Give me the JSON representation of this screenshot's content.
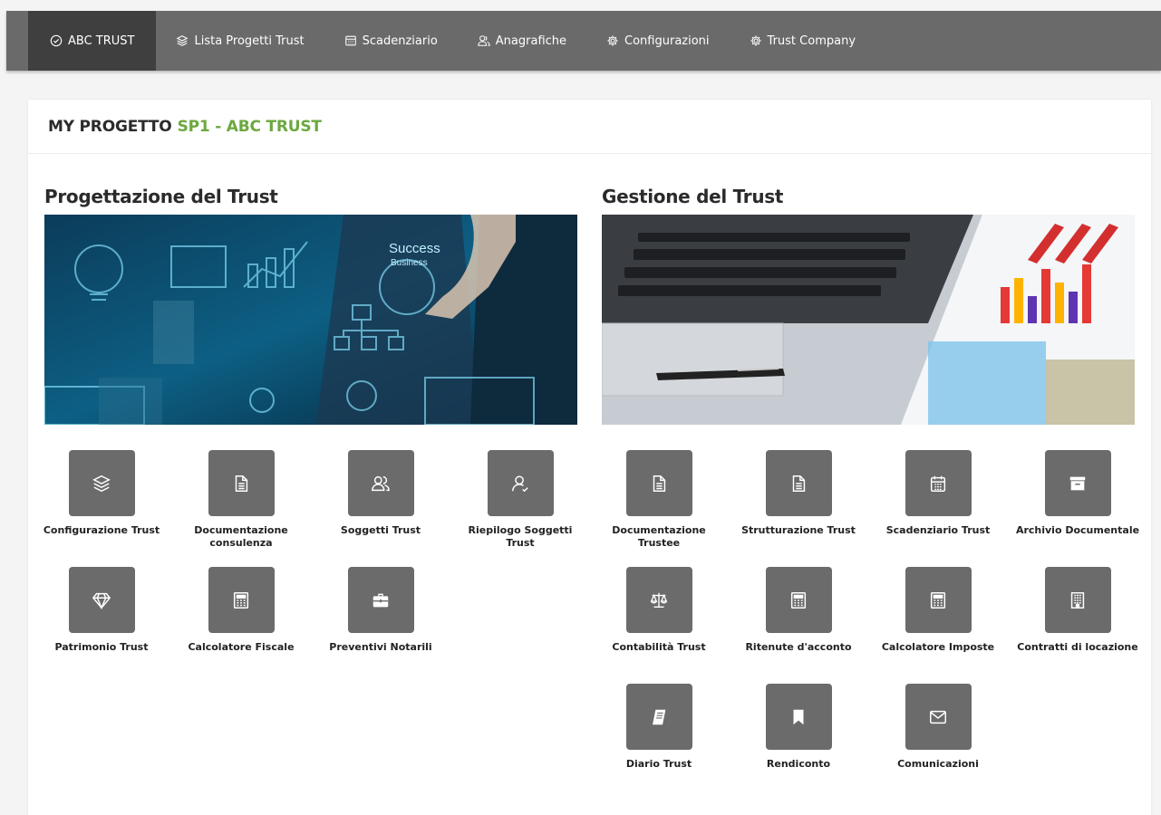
{
  "nav": {
    "items": [
      {
        "label": "ABC TRUST",
        "icon": "check-circle-icon"
      },
      {
        "label": "Lista Progetti Trust",
        "icon": "layers-icon"
      },
      {
        "label": "Scadenziario",
        "icon": "calendar-icon"
      },
      {
        "label": "Anagrafiche",
        "icon": "users-icon"
      },
      {
        "label": "Configurazioni",
        "icon": "gear-icon"
      },
      {
        "label": "Trust Company",
        "icon": "gear-icon"
      }
    ]
  },
  "header": {
    "prefix": "MY PROGETTO",
    "project": "SP1 - ABC TRUST",
    "accent_color": "#6ba83f"
  },
  "left": {
    "title": "Progettazione del Trust",
    "banner_text": [
      "Success",
      "Business"
    ],
    "tiles": [
      {
        "label": "Configurazione Trust",
        "icon": "layers-icon"
      },
      {
        "label": "Documentazione consulenza",
        "icon": "document-icon"
      },
      {
        "label": "Soggetti Trust",
        "icon": "users-icon"
      },
      {
        "label": "Riepilogo Soggetti Trust",
        "icon": "user-check-icon"
      },
      {
        "label": "Patrimonio Trust",
        "icon": "diamond-icon"
      },
      {
        "label": "Calcolatore Fiscale",
        "icon": "calculator-icon"
      },
      {
        "label": "Preventivi Notarili",
        "icon": "briefcase-icon"
      }
    ]
  },
  "right": {
    "title": "Gestione del Trust",
    "tiles": [
      {
        "label": "Documentazione Trustee",
        "icon": "document-icon"
      },
      {
        "label": "Strutturazione Trust",
        "icon": "document-icon"
      },
      {
        "label": "Scadenziario Trust",
        "icon": "calendar-icon"
      },
      {
        "label": "Archivio Documentale",
        "icon": "archive-icon"
      },
      {
        "label": "Contabilità Trust",
        "icon": "scale-icon"
      },
      {
        "label": "Ritenute d'acconto",
        "icon": "calculator-icon"
      },
      {
        "label": "Calcolatore Imposte",
        "icon": "calculator-icon"
      },
      {
        "label": "Contratti di locazione",
        "icon": "building-icon"
      },
      {
        "label": "Diario Trust",
        "icon": "book-icon"
      },
      {
        "label": "Rendiconto",
        "icon": "bookmark-icon"
      },
      {
        "label": "Comunicazioni",
        "icon": "mail-icon"
      }
    ]
  }
}
